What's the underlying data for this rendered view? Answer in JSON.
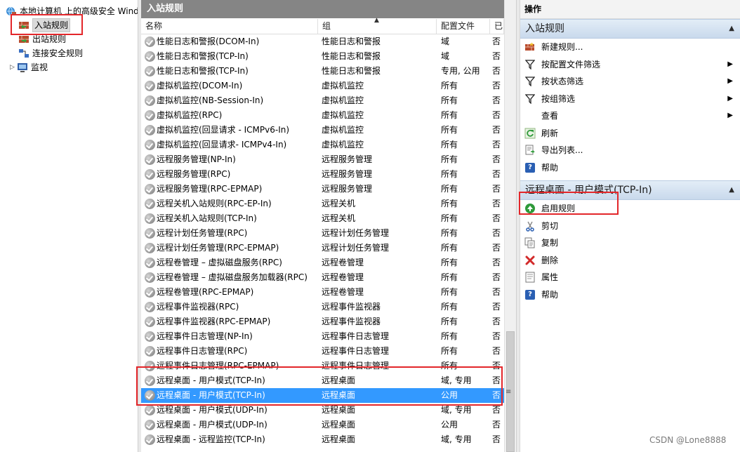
{
  "tree": {
    "root_label": "本地计算机 上的高级安全 Windows",
    "items": [
      {
        "label": "入站规则"
      },
      {
        "label": "出站规则"
      },
      {
        "label": "连接安全规则"
      },
      {
        "label": "监视"
      }
    ]
  },
  "list": {
    "header": "入站规则",
    "columns": {
      "name": "名称",
      "group": "组",
      "profile": "配置文件",
      "enabled": "已启"
    },
    "rows": [
      {
        "name": "性能日志和警报(DCOM-In)",
        "group": "性能日志和警报",
        "profile": "域",
        "enabled": "否"
      },
      {
        "name": "性能日志和警报(TCP-In)",
        "group": "性能日志和警报",
        "profile": "域",
        "enabled": "否"
      },
      {
        "name": "性能日志和警报(TCP-In)",
        "group": "性能日志和警报",
        "profile": "专用, 公用",
        "enabled": "否"
      },
      {
        "name": "虚拟机监控(DCOM-In)",
        "group": "虚拟机监控",
        "profile": "所有",
        "enabled": "否"
      },
      {
        "name": "虚拟机监控(NB-Session-In)",
        "group": "虚拟机监控",
        "profile": "所有",
        "enabled": "否"
      },
      {
        "name": "虚拟机监控(RPC)",
        "group": "虚拟机监控",
        "profile": "所有",
        "enabled": "否"
      },
      {
        "name": "虚拟机监控(回显请求 - ICMPv6-In)",
        "group": "虚拟机监控",
        "profile": "所有",
        "enabled": "否"
      },
      {
        "name": "虚拟机监控(回显请求- ICMPv4-In)",
        "group": "虚拟机监控",
        "profile": "所有",
        "enabled": "否"
      },
      {
        "name": "远程服务管理(NP-In)",
        "group": "远程服务管理",
        "profile": "所有",
        "enabled": "否"
      },
      {
        "name": "远程服务管理(RPC)",
        "group": "远程服务管理",
        "profile": "所有",
        "enabled": "否"
      },
      {
        "name": "远程服务管理(RPC-EPMAP)",
        "group": "远程服务管理",
        "profile": "所有",
        "enabled": "否"
      },
      {
        "name": "远程关机入站规则(RPC-EP-In)",
        "group": "远程关机",
        "profile": "所有",
        "enabled": "否"
      },
      {
        "name": "远程关机入站规则(TCP-In)",
        "group": "远程关机",
        "profile": "所有",
        "enabled": "否"
      },
      {
        "name": "远程计划任务管理(RPC)",
        "group": "远程计划任务管理",
        "profile": "所有",
        "enabled": "否"
      },
      {
        "name": "远程计划任务管理(RPC-EPMAP)",
        "group": "远程计划任务管理",
        "profile": "所有",
        "enabled": "否"
      },
      {
        "name": "远程卷管理 – 虚拟磁盘服务(RPC)",
        "group": "远程卷管理",
        "profile": "所有",
        "enabled": "否"
      },
      {
        "name": "远程卷管理 – 虚拟磁盘服务加载器(RPC)",
        "group": "远程卷管理",
        "profile": "所有",
        "enabled": "否"
      },
      {
        "name": "远程卷管理(RPC-EPMAP)",
        "group": "远程卷管理",
        "profile": "所有",
        "enabled": "否"
      },
      {
        "name": "远程事件监视器(RPC)",
        "group": "远程事件监视器",
        "profile": "所有",
        "enabled": "否"
      },
      {
        "name": "远程事件监视器(RPC-EPMAP)",
        "group": "远程事件监视器",
        "profile": "所有",
        "enabled": "否"
      },
      {
        "name": "远程事件日志管理(NP-In)",
        "group": "远程事件日志管理",
        "profile": "所有",
        "enabled": "否"
      },
      {
        "name": "远程事件日志管理(RPC)",
        "group": "远程事件日志管理",
        "profile": "所有",
        "enabled": "否"
      },
      {
        "name": "远程事件日志管理(RPC-EPMAP)",
        "group": "远程事件日志管理",
        "profile": "所有",
        "enabled": "否"
      },
      {
        "name": "远程桌面 - 用户模式(TCP-In)",
        "group": "远程桌面",
        "profile": "域, 专用",
        "enabled": "否"
      },
      {
        "name": "远程桌面 - 用户模式(TCP-In)",
        "group": "远程桌面",
        "profile": "公用",
        "enabled": "否"
      },
      {
        "name": "远程桌面 - 用户模式(UDP-In)",
        "group": "远程桌面",
        "profile": "域, 专用",
        "enabled": "否"
      },
      {
        "name": "远程桌面 - 用户模式(UDP-In)",
        "group": "远程桌面",
        "profile": "公用",
        "enabled": "否"
      },
      {
        "name": "远程桌面 - 远程监控(TCP-In)",
        "group": "远程桌面",
        "profile": "域, 专用",
        "enabled": "否"
      }
    ]
  },
  "actions": {
    "title": "操作",
    "section1": {
      "title": "入站规则",
      "items": [
        {
          "label": "新建规则...",
          "icon": "new-rule-icon",
          "submenu": false
        },
        {
          "label": "按配置文件筛选",
          "icon": "filter-icon",
          "submenu": true
        },
        {
          "label": "按状态筛选",
          "icon": "filter-icon",
          "submenu": true
        },
        {
          "label": "按组筛选",
          "icon": "filter-icon",
          "submenu": true
        },
        {
          "label": "查看",
          "icon": "",
          "submenu": true
        },
        {
          "label": "刷新",
          "icon": "refresh-icon",
          "submenu": false
        },
        {
          "label": "导出列表...",
          "icon": "export-icon",
          "submenu": false
        },
        {
          "label": "帮助",
          "icon": "help-icon",
          "submenu": false
        }
      ]
    },
    "section2": {
      "title": "远程桌面 - 用户模式(TCP-In)",
      "items": [
        {
          "label": "启用规则",
          "icon": "enable-icon"
        },
        {
          "label": "剪切",
          "icon": "cut-icon"
        },
        {
          "label": "复制",
          "icon": "copy-icon"
        },
        {
          "label": "删除",
          "icon": "delete-icon"
        },
        {
          "label": "属性",
          "icon": "properties-icon"
        },
        {
          "label": "帮助",
          "icon": "help-icon"
        }
      ]
    }
  },
  "watermark": "CSDN @Lone8888",
  "colors": {
    "selection": "#3399ff",
    "annotation": "#e3262a",
    "header_bar": "#858585"
  }
}
